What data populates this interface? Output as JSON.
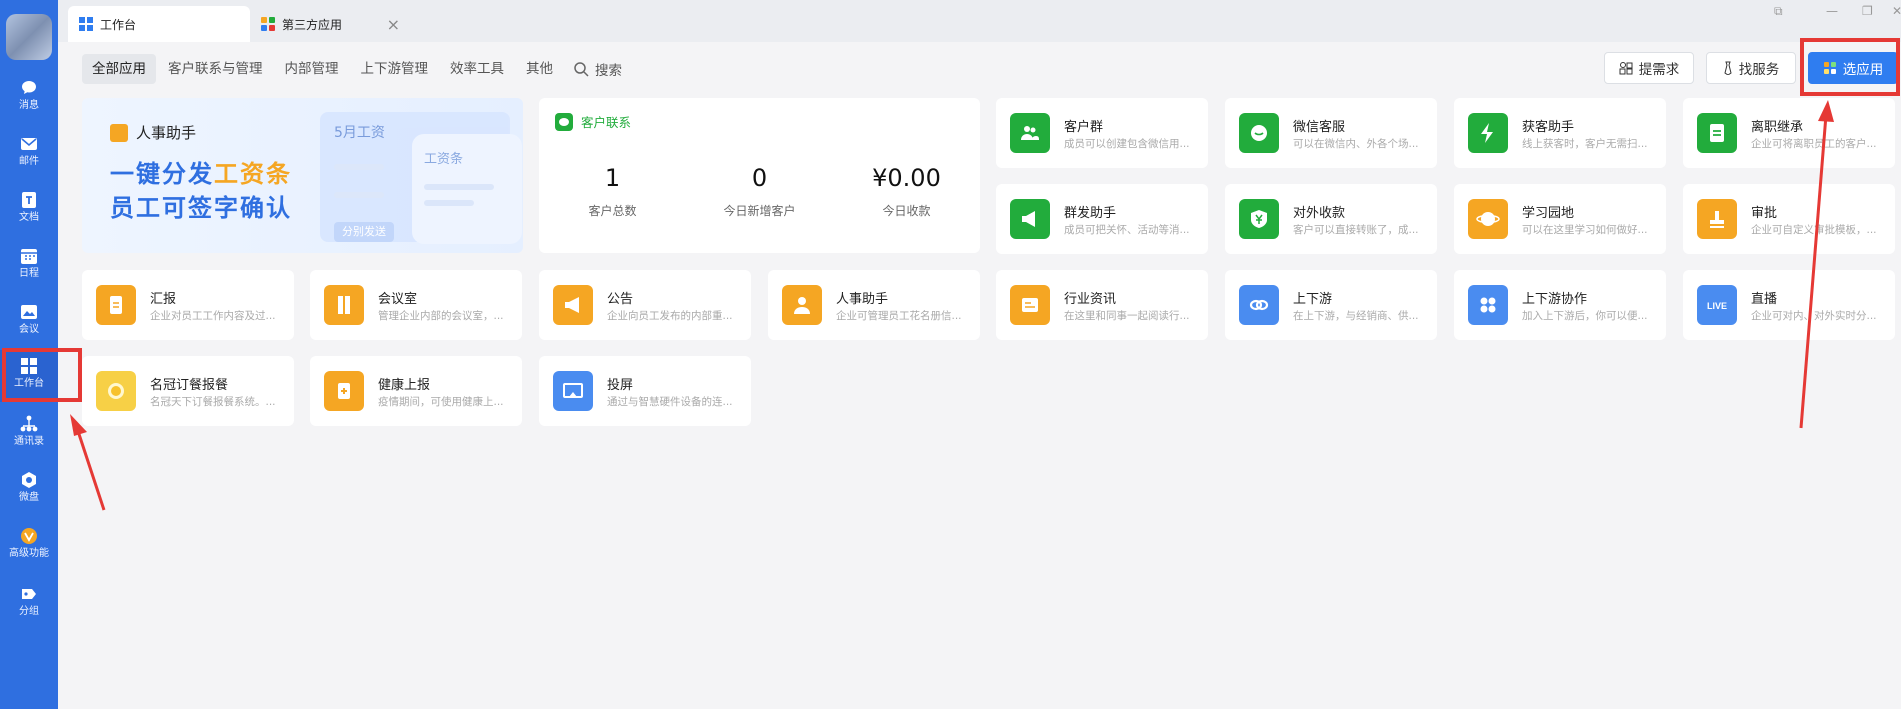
{
  "tabs": [
    {
      "label": "工作台",
      "active": true
    },
    {
      "label": "第三方应用",
      "active": false
    }
  ],
  "sidebar": {
    "items": [
      {
        "label": "消息",
        "icon": "chat-icon"
      },
      {
        "label": "邮件",
        "icon": "mail-icon"
      },
      {
        "label": "文档",
        "icon": "document-icon"
      },
      {
        "label": "日程",
        "icon": "calendar-icon"
      },
      {
        "label": "会议",
        "icon": "meeting-icon"
      },
      {
        "label": "工作台",
        "icon": "workbench-icon",
        "active": true
      },
      {
        "label": "通讯录",
        "icon": "contacts-icon"
      },
      {
        "label": "微盘",
        "icon": "drive-icon"
      },
      {
        "label": "高级功能",
        "icon": "advanced-icon"
      },
      {
        "label": "分组",
        "icon": "group-icon"
      }
    ]
  },
  "categories": [
    "全部应用",
    "客户联系与管理",
    "内部管理",
    "上下游管理",
    "效率工具",
    "其他"
  ],
  "search_label": "搜索",
  "buttons": {
    "request": "提需求",
    "service": "找服务",
    "choose_app": "选应用"
  },
  "banner": {
    "title": "人事助手",
    "line1_a": "一键分发",
    "line1_b": "工资条",
    "line2": "员工可签字确认",
    "month": "5月工资",
    "slip": "工资条",
    "send": "分别发送"
  },
  "customer": {
    "title": "客户联系",
    "stats": [
      {
        "value": "1",
        "label": "客户总数"
      },
      {
        "value": "0",
        "label": "今日新增客户"
      },
      {
        "value": "¥0.00",
        "label": "今日收款"
      }
    ]
  },
  "apps": [
    {
      "title": "客户群",
      "desc": "成员可以创建包含微信用...",
      "color": "#22ac3c",
      "icon": "people-icon"
    },
    {
      "title": "微信客服",
      "desc": "可以在微信内、外各个场...",
      "color": "#22ac3c",
      "icon": "chat-bubble-icon"
    },
    {
      "title": "获客助手",
      "desc": "线上获客时，客户无需扫...",
      "color": "#22ac3c",
      "icon": "lightning-icon"
    },
    {
      "title": "离职继承",
      "desc": "企业可将离职员工的客户...",
      "color": "#22ac3c",
      "icon": "doc-lines-icon"
    },
    {
      "title": "群发助手",
      "desc": "成员可把关怀、活动等消...",
      "color": "#22ac3c",
      "icon": "megaphone-icon"
    },
    {
      "title": "对外收款",
      "desc": "客户可以直接转账了，成...",
      "color": "#22ac3c",
      "icon": "yuan-shield-icon"
    },
    {
      "title": "学习园地",
      "desc": "可以在这里学习如何做好...",
      "color": "#f5a623",
      "icon": "planet-icon"
    },
    {
      "title": "审批",
      "desc": "企业可自定义审批模板，...",
      "color": "#f5a623",
      "icon": "stamp-icon"
    },
    {
      "title": "汇报",
      "desc": "企业对员工工作内容及过...",
      "color": "#f5a623",
      "icon": "report-icon"
    },
    {
      "title": "会议室",
      "desc": "管理企业内部的会议室，...",
      "color": "#f5a623",
      "icon": "door-icon"
    },
    {
      "title": "公告",
      "desc": "企业向员工发布的内部重...",
      "color": "#f5a623",
      "icon": "announce-icon"
    },
    {
      "title": "人事助手",
      "desc": "企业可管理员工花名册信...",
      "color": "#f5a623",
      "icon": "person-icon"
    },
    {
      "title": "行业资讯",
      "desc": "在这里和同事一起阅读行...",
      "color": "#f5a623",
      "icon": "news-icon"
    },
    {
      "title": "上下游",
      "desc": "在上下游，与经销商、供...",
      "color": "#4a8cf0",
      "icon": "link-icon"
    },
    {
      "title": "上下游协作",
      "desc": "加入上下游后，你可以便...",
      "color": "#4a8cf0",
      "icon": "apps-grid-icon"
    },
    {
      "title": "直播",
      "desc": "企业可对内、对外实时分...",
      "color": "#4a8cf0",
      "icon": "live-icon"
    },
    {
      "title": "名冠订餐报餐",
      "desc": "名冠天下订餐报餐系统。...",
      "color": "#f7d046",
      "icon": "meal-icon"
    },
    {
      "title": "健康上报",
      "desc": "疫情期间，可使用健康上...",
      "color": "#f5a623",
      "icon": "health-icon"
    },
    {
      "title": "投屏",
      "desc": "通过与智慧硬件设备的连...",
      "color": "#4a8cf0",
      "icon": "cast-icon"
    }
  ]
}
